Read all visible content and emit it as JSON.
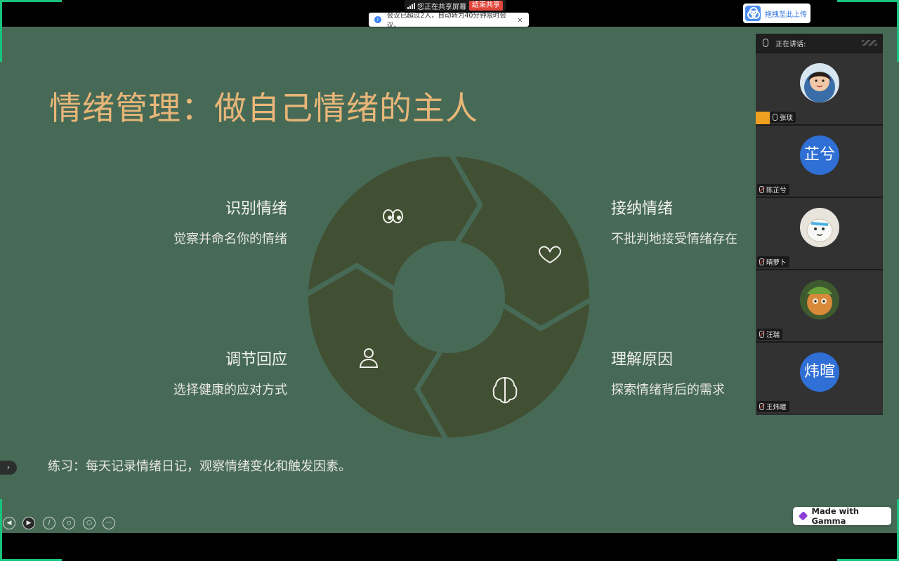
{
  "share_bar": {
    "sharing_text": "您正在共享屏幕",
    "end_share_label": "结束共享"
  },
  "notice": {
    "text": "会议已超过2人，自动转为40分钟限时会议。",
    "close": "×"
  },
  "upload_button": {
    "label": "拖拽至此上传"
  },
  "slide": {
    "title": "情绪管理：做自己情绪的主人",
    "steps": [
      {
        "heading": "识别情绪",
        "desc": "觉察并命名你的情绪",
        "icon": "eyes-icon"
      },
      {
        "heading": "接纳情绪",
        "desc": "不批判地接受情绪存在",
        "icon": "heart-icon"
      },
      {
        "heading": "理解原因",
        "desc": "探索情绪背后的需求",
        "icon": "brain-icon"
      },
      {
        "heading": "调节回应",
        "desc": "选择健康的应对方式",
        "icon": "person-icon"
      }
    ],
    "practice": "练习：每天记录情绪日记，观察情绪变化和触发因素。",
    "colors": {
      "background": "#476a56",
      "ring": "#414f33",
      "title": "#e8b678"
    }
  },
  "participants_panel": {
    "speaking_label": "正在讲话:",
    "participants": [
      {
        "name": "张琰",
        "avatar_text": "",
        "muted": false,
        "host": true
      },
      {
        "name": "陈芷兮",
        "avatar_text": "芷兮",
        "muted": true,
        "host": false
      },
      {
        "name": "晴萝卜",
        "avatar_text": "",
        "muted": true,
        "host": false
      },
      {
        "name": "汪瑞",
        "avatar_text": "",
        "muted": true,
        "host": false
      },
      {
        "name": "王炜暄",
        "avatar_text": "炜暄",
        "muted": true,
        "host": false
      }
    ]
  },
  "controls": {
    "icons": [
      "prev-icon",
      "play-icon",
      "pen-icon",
      "copy-icon",
      "zoom-icon",
      "more-icon"
    ],
    "side_tab": "›"
  },
  "gamma_badge": {
    "label": "Made with Gamma"
  }
}
